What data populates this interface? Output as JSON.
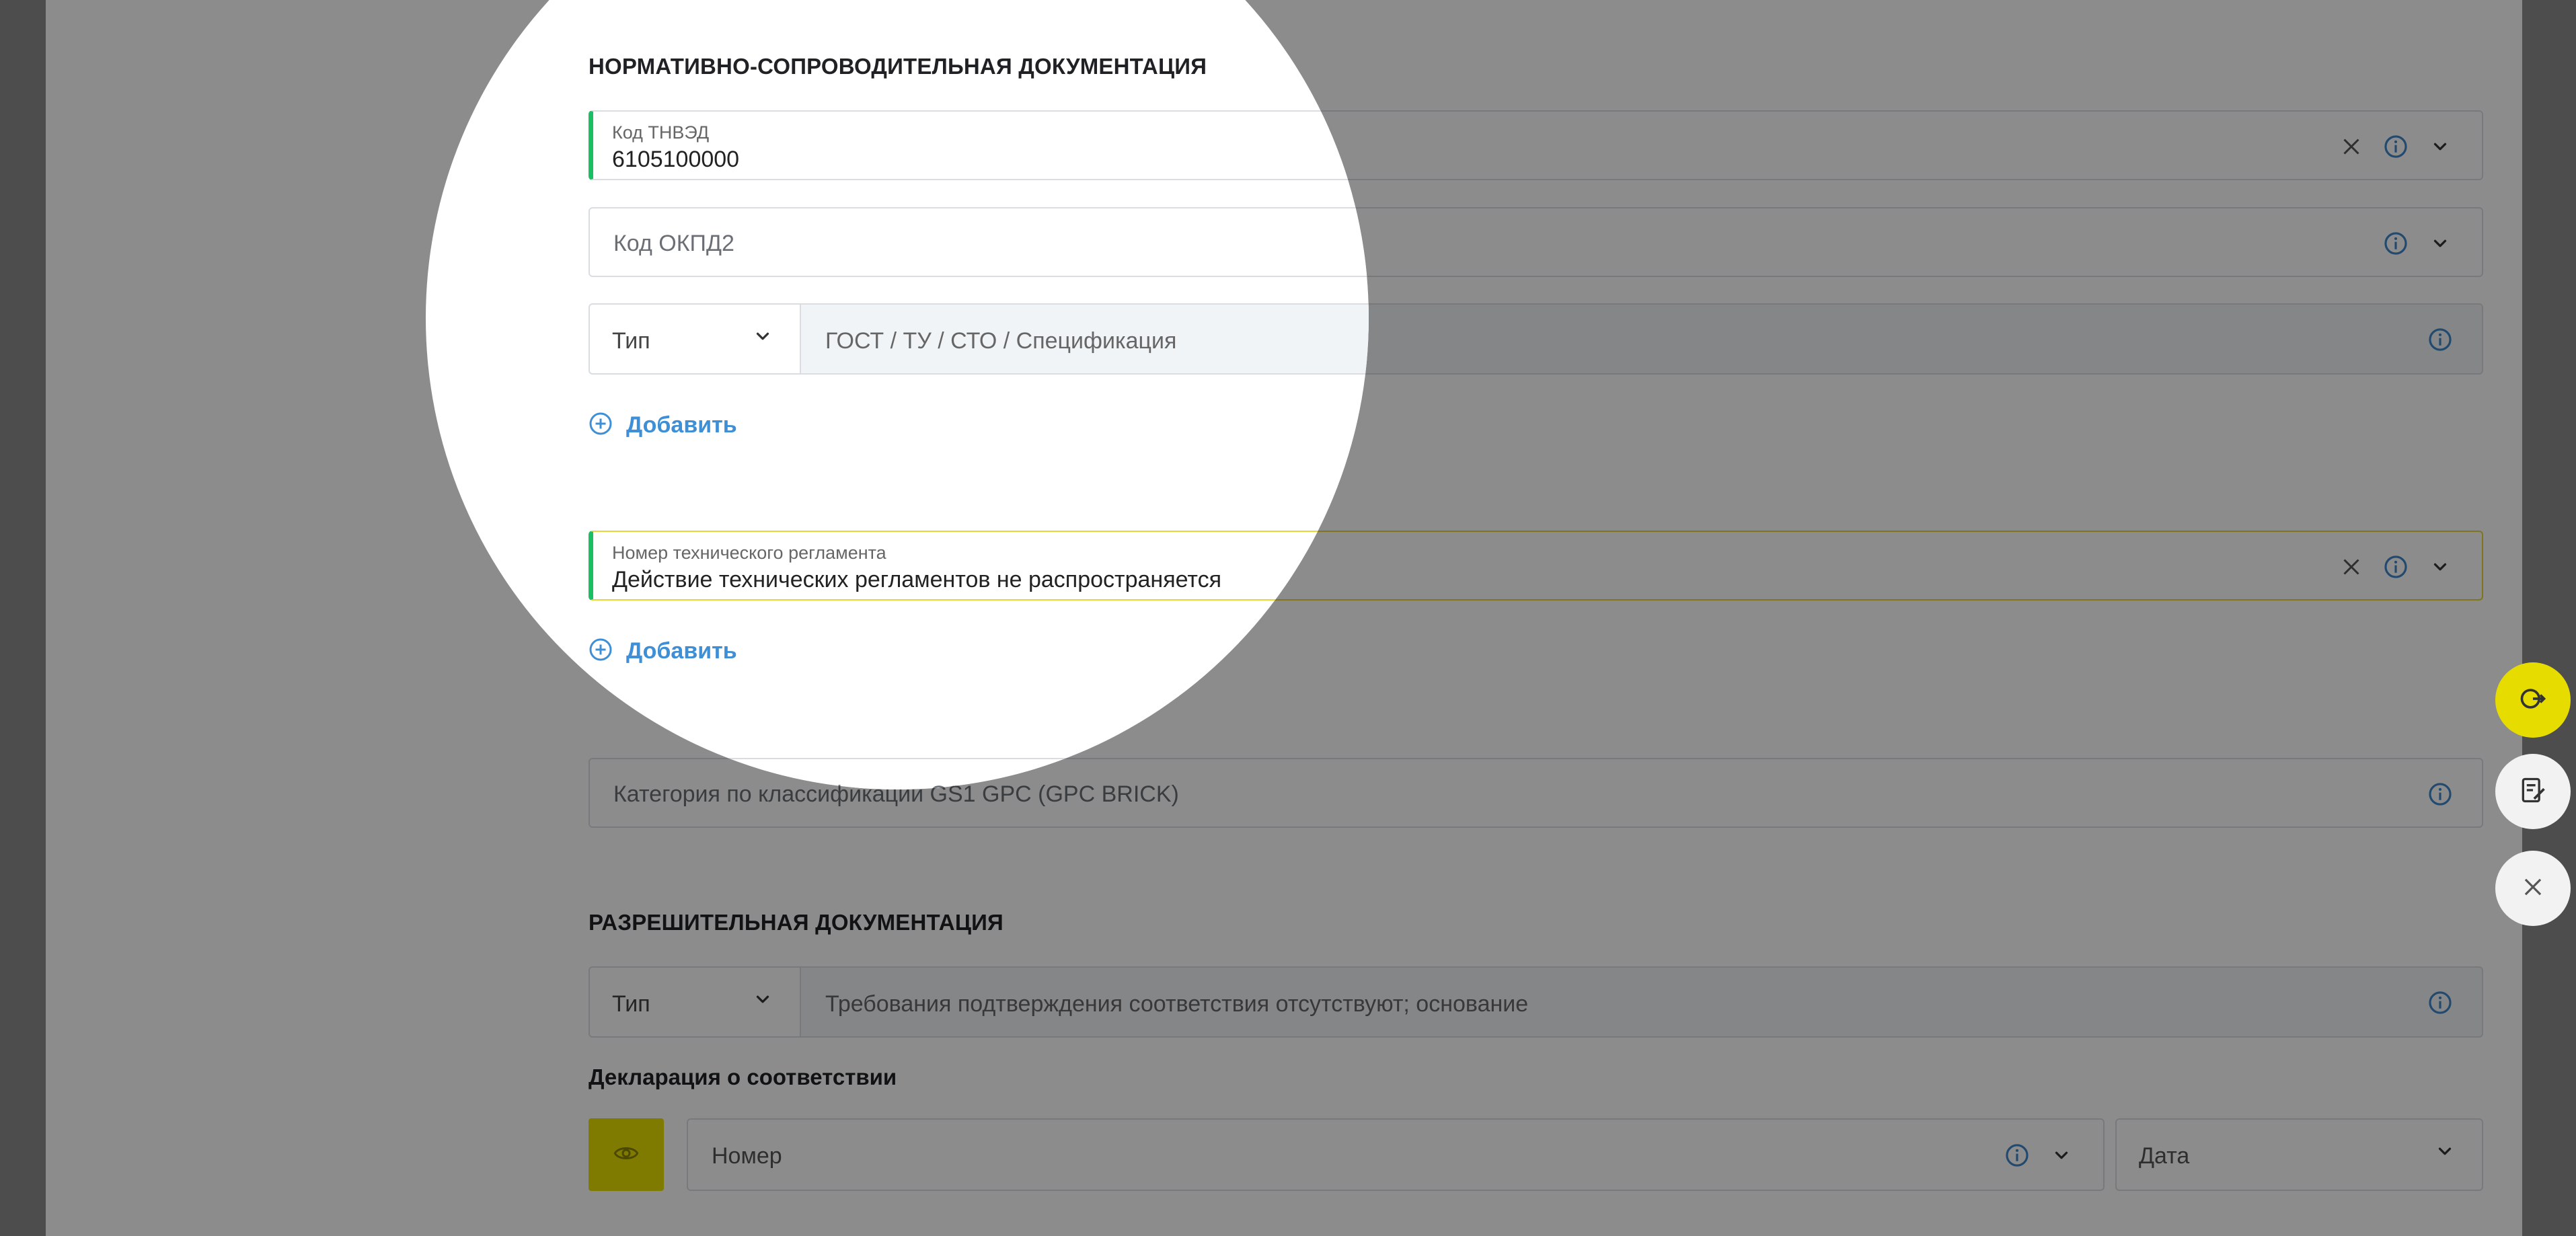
{
  "regulatory": {
    "section_title": "НОРМАТИВНО-СОПРОВОДИТЕЛЬНАЯ ДОКУМЕНТАЦИЯ",
    "tnved_label": "Код ТНВЭД",
    "tnved_value": "6105100000",
    "okpd2_placeholder": "Код ОКПД2",
    "type_label": "Тип",
    "gost_placeholder": "ГОСТ / ТУ / СТО / Спецификация",
    "add_label": "Добавить",
    "tech_reg_label": "Номер технического регламента",
    "tech_reg_value": "Действие технических регламентов не распространяется",
    "add_label_2": "Добавить",
    "gs1_placeholder": "Категория по классификации GS1 GPC (GPC BRICK)"
  },
  "permits": {
    "section_title": "РАЗРЕШИТЕЛЬНАЯ ДОКУМЕНТАЦИЯ",
    "type_label": "Тип",
    "requirements_placeholder": "Требования подтверждения соответствия отсутствуют; основание",
    "declaration_title": "Декларация о соответствии",
    "number_placeholder": "Номер",
    "date_placeholder": "Дата"
  },
  "icons": {
    "clear": "close-icon",
    "info": "info-icon",
    "chevron": "chevron-down-icon",
    "add": "plus-circle-icon",
    "eye": "eye-icon"
  },
  "colors": {
    "accent_blue": "#3f8fd6",
    "filled_green": "#1bbf63",
    "highlight_yellow": "#e6dc00"
  }
}
